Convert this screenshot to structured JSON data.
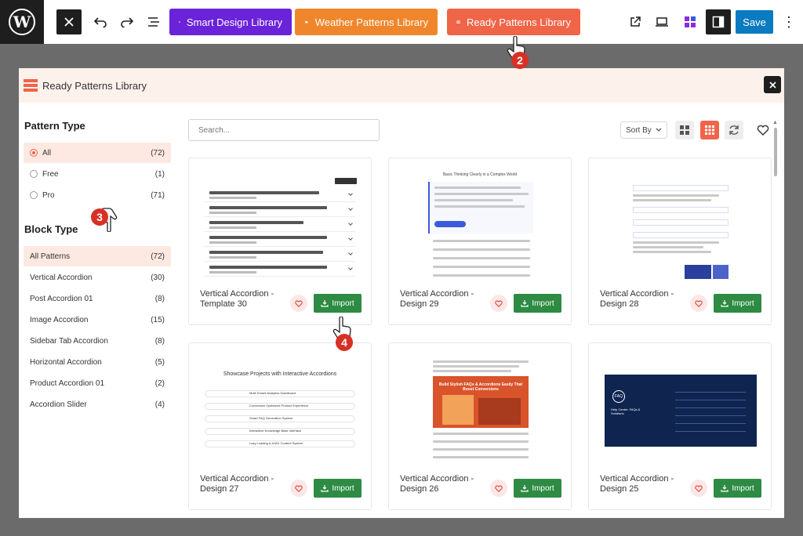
{
  "toolbar": {
    "libraries": [
      {
        "label": "Smart Design Library"
      },
      {
        "label": "Weather Patterns Library"
      },
      {
        "label": "Ready Patterns Library"
      }
    ],
    "save_label": "Save"
  },
  "modal": {
    "title": "Ready Patterns Library",
    "search_placeholder": "Search...",
    "sort_label": "Sort By"
  },
  "sidebar": {
    "pattern_type_heading": "Pattern Type",
    "pattern_types": [
      {
        "label": "All",
        "count": "(72)",
        "selected": true
      },
      {
        "label": "Free",
        "count": "(1)",
        "selected": false
      },
      {
        "label": "Pro",
        "count": "(71)",
        "selected": false
      }
    ],
    "block_type_heading": "Block Type",
    "block_types": [
      {
        "label": "All Patterns",
        "count": "(72)"
      },
      {
        "label": "Vertical Accordion",
        "count": "(30)"
      },
      {
        "label": "Post Accordion 01",
        "count": "(8)"
      },
      {
        "label": "Image Accordion",
        "count": "(15)"
      },
      {
        "label": "Sidebar Tab Accordion",
        "count": "(8)"
      },
      {
        "label": "Horizontal Accordion",
        "count": "(5)"
      },
      {
        "label": "Product Accordion 01",
        "count": "(2)"
      },
      {
        "label": "Accordion Slider",
        "count": "(4)"
      }
    ]
  },
  "cards": [
    {
      "title": "Vertical Accordion - Template 30",
      "import_label": "Import"
    },
    {
      "title": "Vertical Accordion - Design 29",
      "import_label": "Import"
    },
    {
      "title": "Vertical Accordion - Design 28",
      "import_label": "Import"
    },
    {
      "title": "Vertical Accordion - Design 27",
      "import_label": "Import"
    },
    {
      "title": "Vertical Accordion - Design 26",
      "import_label": "Import"
    },
    {
      "title": "Vertical Accordion - Design 25",
      "import_label": "Import"
    }
  ],
  "thumbnails": {
    "design_29_heading": "Basic Thinking Clearly in a Complex World",
    "design_27_heading": "Showcase Projects with Interactive Accordions",
    "design_27_rows": [
      "Multi Tenant Analytics Dashboard",
      "Conversion Optimized Product Experience",
      "Smart FAQ Generation System",
      "Interactive Knowledge Base Interface",
      "Lazy Loading & AJAX Content System"
    ],
    "design_26_banner": "Build Stylish FAQs & Accordions Easily That Boost Conversions",
    "design_25_badge": "FAQ",
    "design_25_heading": "Help Center: FAQs & Solutions"
  },
  "callouts": [
    "2",
    "3",
    "4"
  ],
  "colors": {
    "accent": "#f06448",
    "smart": "#6a23d9",
    "weather": "#f0862c",
    "import_green": "#2e8b43",
    "save_blue": "#0a7bc0"
  }
}
